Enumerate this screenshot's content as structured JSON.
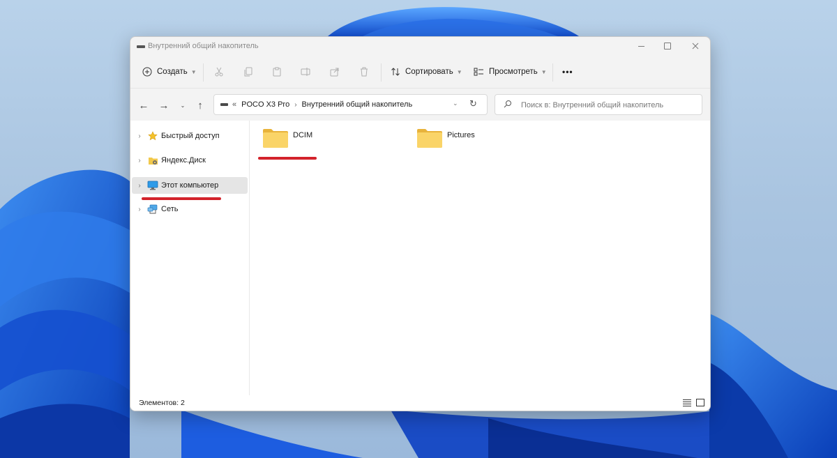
{
  "window": {
    "title": "Внутренний общий накопитель"
  },
  "toolbar": {
    "create_label": "Создать",
    "sort_label": "Сортировать",
    "view_label": "Просмотреть",
    "more_label": "•••"
  },
  "address": {
    "overflow": "«",
    "segments": [
      "POCO X3 Pro",
      "Внутренний общий накопитель"
    ]
  },
  "search": {
    "placeholder": "Поиск в: Внутренний общий накопитель"
  },
  "sidebar": {
    "items": [
      {
        "label": "Быстрый доступ",
        "icon": "star-icon"
      },
      {
        "label": "Яндекс.Диск",
        "icon": "yandex-disk-icon"
      },
      {
        "label": "Этот компьютер",
        "icon": "computer-icon",
        "selected": true
      },
      {
        "label": "Сеть",
        "icon": "network-icon"
      }
    ]
  },
  "content": {
    "folders": [
      {
        "name": "DCIM",
        "highlighted": true
      },
      {
        "name": "Pictures"
      }
    ]
  },
  "status": {
    "items_count": "Элементов: 2"
  },
  "colors": {
    "accent_underline": "#d3232b",
    "folder": "#f8cf5a",
    "wallpaper_blue": "#1a5fd8"
  }
}
